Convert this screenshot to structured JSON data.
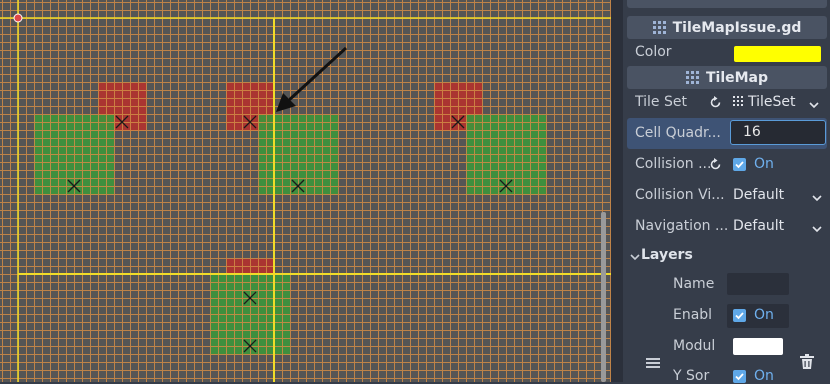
{
  "inspector": {
    "script_header": "TileMapIssue.gd",
    "color_label": "Color",
    "color_value": "#ffff00",
    "tilemap_header": "TileMap",
    "tile_set_label": "Tile Set",
    "tile_set_value": "TileSet",
    "cell_quadrant_label": "Cell Quadr...",
    "cell_quadrant_value": "16",
    "collision_label": "Collision ...",
    "collision_value": "On",
    "collision_vis_label": "Collision Vi...",
    "collision_vis_value": "Default",
    "navigation_label": "Navigation ...",
    "navigation_value": "Default",
    "layers_header": "Layers",
    "layer_name_label": "Name",
    "layer_enabled_label": "Enabl",
    "layer_enabled_value": "On",
    "layer_modulate_label": "Modul",
    "layer_modulate_color": "#ffffff",
    "layer_ysort_label": "Y Sor",
    "layer_ysort_value": "On"
  },
  "icons": {
    "script": "script-icon",
    "tilemap": "tilemap-icon",
    "revert": "revert-icon",
    "tileset": "tileset-icon",
    "chevron": "chevron-down-icon",
    "checkbox": "checkbox-checked-icon",
    "drag": "drag-handle-icon",
    "delete": "trash-icon",
    "origin": "origin-icon",
    "arrow": "annotation-arrow-icon"
  },
  "colors": {
    "grid_line": "#d28c46",
    "axis_line": "#f0dc28",
    "tile_red": "#b4322d",
    "tile_green": "#3c963c",
    "viewport_bg": "#555555",
    "accent_blue": "#5fa8e8"
  }
}
